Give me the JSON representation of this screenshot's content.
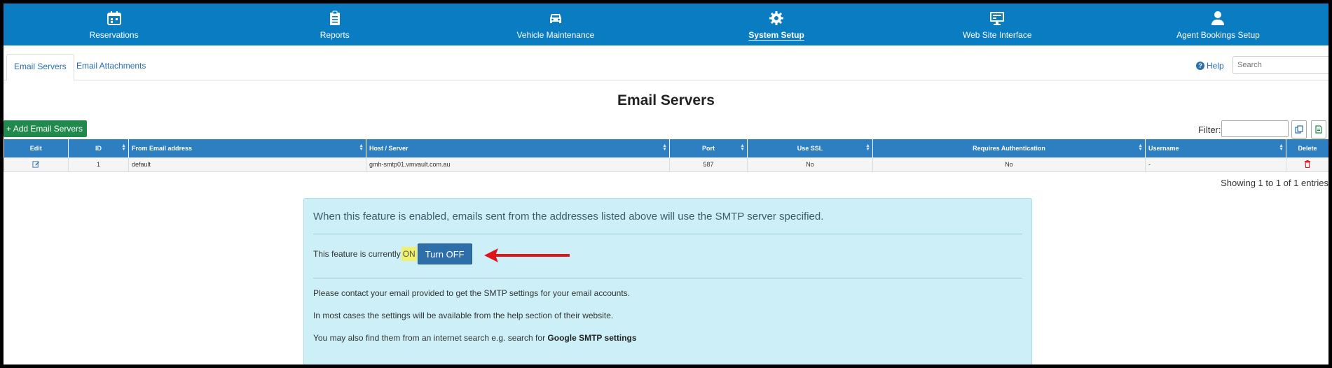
{
  "nav": [
    {
      "label": "Reservations",
      "icon": "calendar-icon"
    },
    {
      "label": "Reports",
      "icon": "clipboard-icon"
    },
    {
      "label": "Vehicle Maintenance",
      "icon": "car-icon"
    },
    {
      "label": "System Setup",
      "icon": "gear-icon",
      "active": true
    },
    {
      "label": "Web Site Interface",
      "icon": "monitor-icon"
    },
    {
      "label": "Agent Bookings Setup",
      "icon": "user-icon"
    }
  ],
  "tabs": [
    {
      "label": "Email Servers",
      "active": true
    },
    {
      "label": "Email Attachments"
    }
  ],
  "help_label": "Help",
  "search_placeholder": "Search",
  "page_title": "Email Servers",
  "add_button": "Add Email Servers",
  "filter_label": "Filter:",
  "table": {
    "columns": [
      "Edit",
      "ID",
      "From Email address",
      "Host / Server",
      "Port",
      "Use SSL",
      "Requires Authentication",
      "Username",
      "Delete"
    ],
    "rows": [
      {
        "id": "1",
        "from": "default",
        "host": "gmh-smtp01.vmvault.com.au",
        "port": "587",
        "ssl": "No",
        "auth": "No",
        "username": "-"
      }
    ]
  },
  "showing_text": "Showing 1 to 1 of 1 entries",
  "panel": {
    "lead": "When this feature is enabled, emails sent from the addresses listed above will use the SMTP server specified.",
    "feature_prefix": "This feature is currently",
    "feature_state": "ON",
    "toggle_button": "Turn OFF",
    "line1": "Please contact your email provided to get the SMTP settings for your email accounts.",
    "line2": "In most cases the settings will be available from the help section of their website.",
    "line3_prefix": "You may also find them from an internet search e.g. search for ",
    "line3_bold": "Google SMTP settings"
  },
  "colors": {
    "nav_bg": "#0a7dc2",
    "table_header": "#2e7ec2",
    "add_button": "#1f8a4c",
    "panel_bg": "#cdf0f8",
    "highlight": "#f0f06c",
    "arrow": "#e0151b"
  }
}
